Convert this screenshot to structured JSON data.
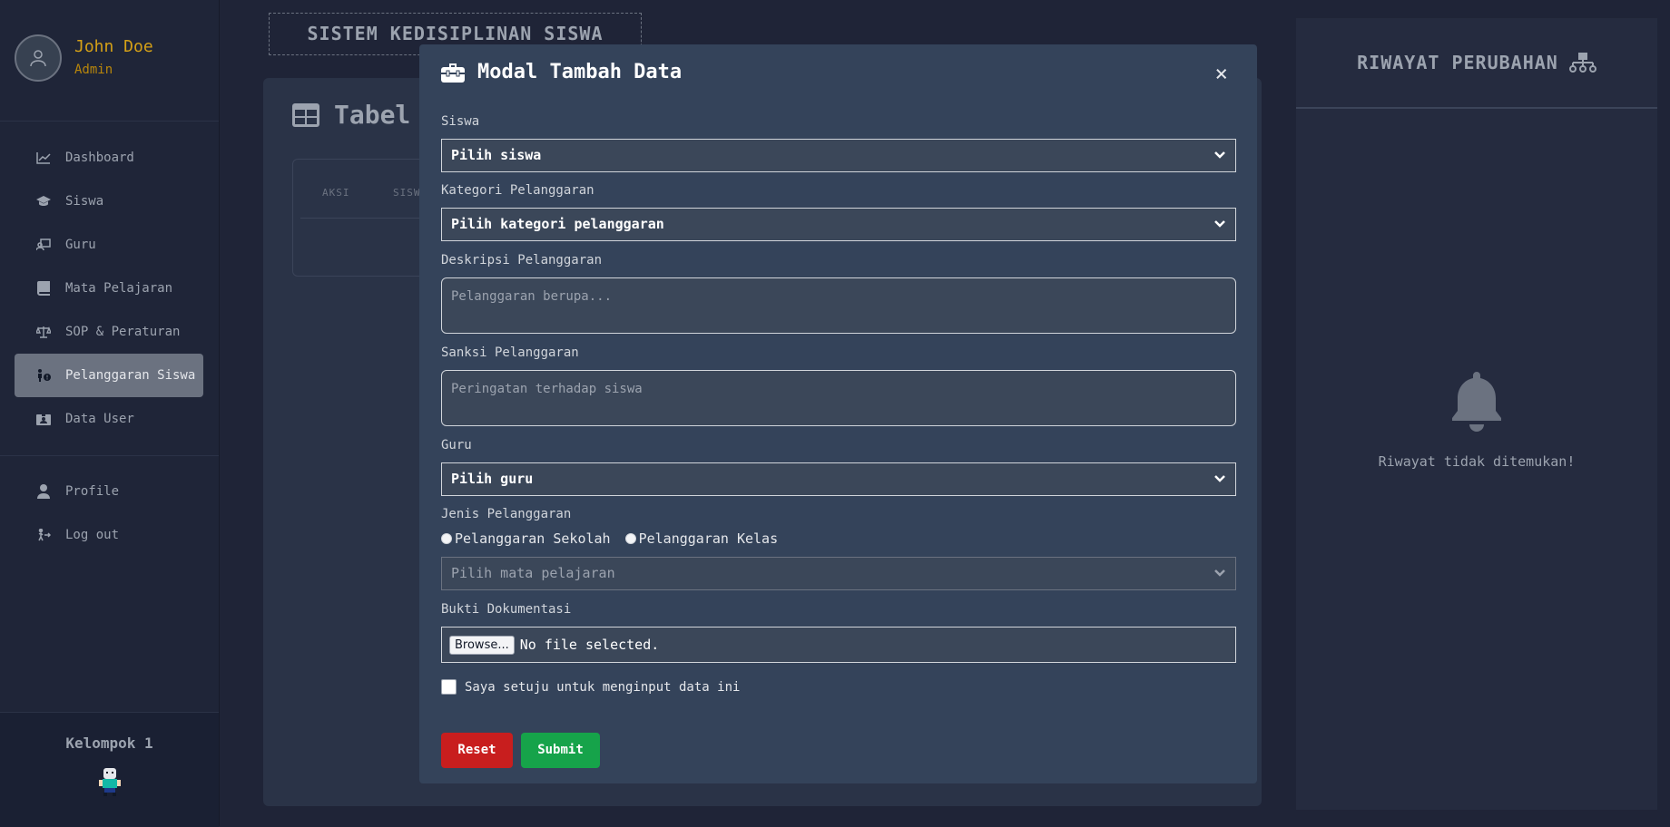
{
  "user": {
    "name": "John Doe",
    "role": "Admin"
  },
  "sidebar": {
    "items": [
      {
        "label": "Dashboard",
        "icon": "chart-line-icon"
      },
      {
        "label": "Siswa",
        "icon": "graduation-cap-icon"
      },
      {
        "label": "Guru",
        "icon": "teacher-icon"
      },
      {
        "label": "Mata Pelajaran",
        "icon": "book-icon"
      },
      {
        "label": "SOP & Peraturan",
        "icon": "scale-icon"
      },
      {
        "label": "Pelanggaran Siswa",
        "icon": "person-warning-icon",
        "active": true
      },
      {
        "label": "Data User",
        "icon": "id-card-icon"
      }
    ],
    "bottom_items": [
      {
        "label": "Profile",
        "icon": "user-icon"
      },
      {
        "label": "Log out",
        "icon": "logout-icon"
      }
    ],
    "footer": {
      "group": "Kelompok 1"
    }
  },
  "header": {
    "app_title": "SISTEM KEDISIPLINAN SISWA"
  },
  "main": {
    "title": "Tabel",
    "table": {
      "columns": [
        "AKSI",
        "SISW"
      ]
    }
  },
  "right_panel": {
    "title": "RIWAYAT PERUBAHAN",
    "empty_text": "Riwayat tidak ditemukan!"
  },
  "modal": {
    "title": "Modal Tambah Data",
    "close": "×",
    "fields": {
      "siswa": {
        "label": "Siswa",
        "value": "Pilih siswa"
      },
      "kategori": {
        "label": "Kategori Pelanggaran",
        "value": "Pilih kategori pelanggaran"
      },
      "deskripsi": {
        "label": "Deskripsi Pelanggaran",
        "placeholder": "Pelanggaran berupa..."
      },
      "sanksi": {
        "label": "Sanksi Pelanggaran",
        "placeholder": "Peringatan terhadap siswa"
      },
      "guru": {
        "label": "Guru",
        "value": "Pilih guru"
      },
      "jenis": {
        "label": "Jenis Pelanggaran",
        "options": [
          "Pelanggaran Sekolah",
          "Pelanggaran Kelas"
        ]
      },
      "mapel": {
        "value": "Pilih mata pelajaran"
      },
      "bukti": {
        "label": "Bukti Dokumentasi",
        "browse": "Browse...",
        "status": "No file selected."
      },
      "agree": {
        "label": "Saya setuju untuk menginput data ini"
      }
    },
    "buttons": {
      "reset": "Reset",
      "submit": "Submit"
    }
  },
  "colors": {
    "accent_gold": "#d4a017",
    "modal_bg": "#34435a",
    "reset": "#c81e1e",
    "submit": "#16a34a"
  }
}
